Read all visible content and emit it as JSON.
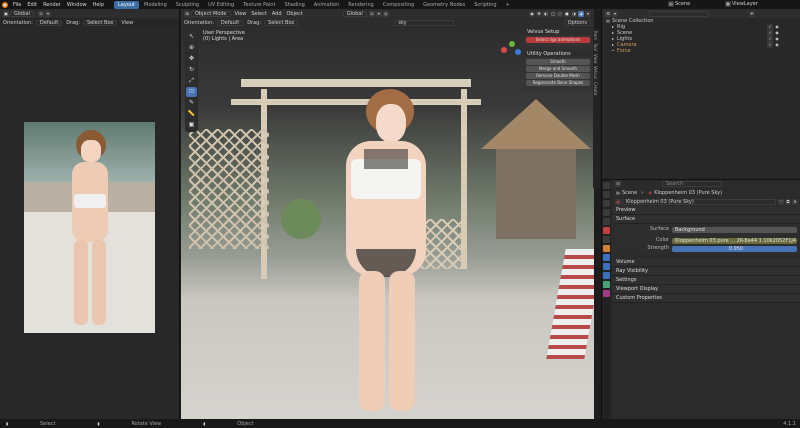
{
  "topbar": {
    "menus": [
      "File",
      "Edit",
      "Render",
      "Window",
      "Help"
    ],
    "workspaces": [
      "Layout",
      "Modeling",
      "Sculpting",
      "UV Editing",
      "Texture Paint",
      "Shading",
      "Animation",
      "Rendering",
      "Compositing",
      "Geometry Nodes",
      "Scripting"
    ],
    "active_workspace": "Layout",
    "scene_name": "Scene",
    "view_layer": "ViewLayer"
  },
  "left_editor": {
    "orientation_label": "Orientation:",
    "orientation_value": "Default",
    "drag_label": "Drag:",
    "drag_value": "Select Box",
    "view_menu": "View"
  },
  "viewport": {
    "mode": "Object Mode",
    "menus": [
      "View",
      "Select",
      "Add",
      "Object"
    ],
    "transform": "Global",
    "orientation_label": "Orientation:",
    "orientation_value": "Default",
    "drag_label": "Drag:",
    "drag_value": "Select Box",
    "overlay_title": "User Perspective",
    "overlay_subtitle": "(0) Lights | Area",
    "sky_label": "sky",
    "options": "Options"
  },
  "npanel": {
    "velvus_title": "Velvus Setup",
    "velvus_btn": "Select rigs animations",
    "utility_title": "Utility Operations",
    "buttons": [
      "Smooth",
      "Merge and Smooth",
      "Remove Double Mesh",
      "Regenerate Bone Shapes"
    ],
    "side_tabs": [
      "Item",
      "Tool",
      "View",
      "Velvus",
      "Create"
    ]
  },
  "outliner": {
    "header": "Scene Collection",
    "items": [
      "Rig",
      "Scene",
      "Lights",
      "Camera",
      "Force"
    ]
  },
  "properties": {
    "search_placeholder": "Search",
    "breadcrumb_scene": "Scene",
    "breadcrumb_world": "Kloppenheim 03 (Pure Sky)",
    "world_name": "Kloppenheim 03 (Pure Sky)",
    "sections": [
      "Preview",
      "Surface"
    ],
    "surface_label": "Surface",
    "surface_value": "Background",
    "color_label": "Color",
    "color_value": "Kloppenheim 03 pure ... 2K-8a44 1 10k2052F1J4",
    "strength_label": "Strength",
    "strength_value": "0.950",
    "more_sections": [
      "Volume",
      "Ray Visibility",
      "Settings",
      "Viewport Display",
      "Custom Properties"
    ]
  },
  "statusbar": {
    "select": "Select",
    "rotate": "Rotate View",
    "object": "Object",
    "version": "4.1.1"
  },
  "colors": {
    "accent": "#4772b3",
    "red_button": "#b93a3a"
  }
}
